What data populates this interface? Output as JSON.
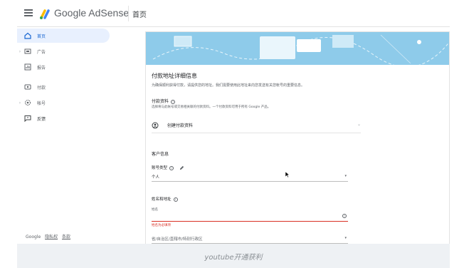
{
  "topbar": {
    "brand_google": "Google",
    "brand_product": "AdSense",
    "page_title": "首页"
  },
  "sidebar": {
    "items": [
      {
        "label": "首页",
        "icon": "home-icon",
        "active": true
      },
      {
        "label": "广告",
        "icon": "ads-icon",
        "active": false
      },
      {
        "label": "报告",
        "icon": "reports-icon",
        "active": false
      },
      {
        "label": "付款",
        "icon": "payments-icon",
        "active": false
      },
      {
        "label": "帐号",
        "icon": "account-gear-icon",
        "active": false
      },
      {
        "label": "反馈",
        "icon": "feedback-icon",
        "active": false
      }
    ],
    "footer": [
      "Google",
      "隐私权",
      "条款"
    ]
  },
  "card": {
    "title": "付款地址详细信息",
    "subtitle": "为确保顺利获得付款，请提供您的地址。我们需要使用此地址来向您发送有关您帐号的重要信息。",
    "payment_profile": {
      "label": "付款资料",
      "desc": "选择将与此帐号或交易相关联的付款资料。一个付款资料可用于所有 Google 产品。",
      "create_label": "创建付款资料"
    },
    "customer_info": {
      "heading": "客户信息",
      "account_type_label": "账号类型",
      "account_type_value": "个人",
      "name_address_label": "姓名和地址",
      "name_placeholder": "姓名",
      "name_error": "姓名为必填项",
      "region_placeholder": "省/自治区/直辖市/特别行政区"
    }
  },
  "caption": "youtube开通获利",
  "colors": {
    "accent": "#1967d2",
    "banner": "#8ecbea",
    "error": "#d93025"
  }
}
